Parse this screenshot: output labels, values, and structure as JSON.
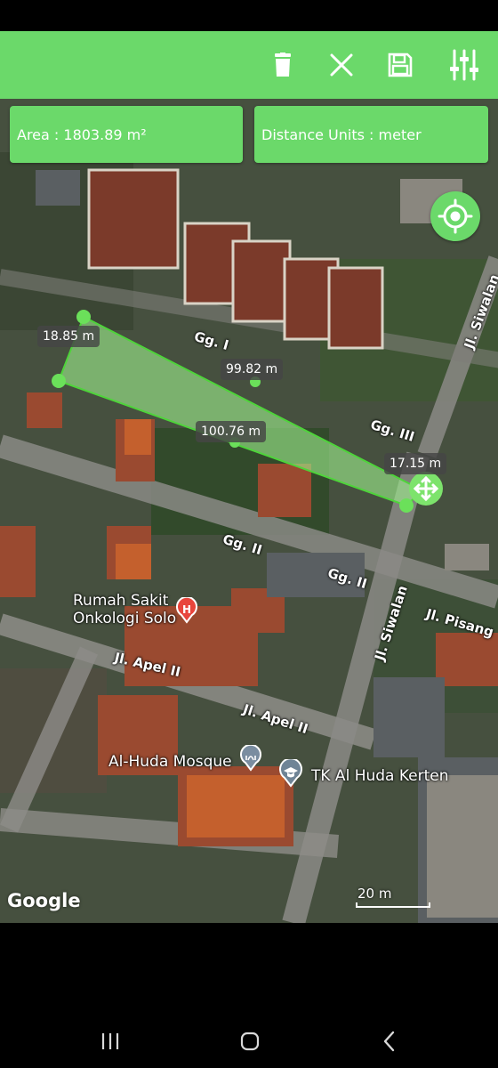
{
  "toolbar": {
    "delete_icon": "trash-icon",
    "close_icon": "close-icon",
    "save_icon": "save-icon",
    "settings_icon": "sliders-icon",
    "color": "#6bd96a"
  },
  "info": {
    "area": "Area : 1803.89 m²",
    "distance_units": "Distance Units : meter"
  },
  "map": {
    "locate_icon": "crosshair-icon",
    "move_icon": "move-icon",
    "polygon_fill": "#9ef28e",
    "polygon_stroke": "#4ed43a",
    "distance_labels": [
      "18.85 m",
      "99.82 m",
      "100.76 m",
      "17.15 m"
    ],
    "streets": {
      "gg1": "Gg. I",
      "gg3": "Gg. III",
      "gg2_a": "Gg. II",
      "gg2_b": "Gg. II",
      "siwalan_top": "Jl. Siwalan",
      "siwalan": "Jl. Siwalan",
      "pisang": "Jl. Pisang",
      "apel_a": "Jl. Apel II",
      "apel_b": "Jl. Apel II"
    },
    "pois": {
      "hospital_line1": "Rumah Sakit",
      "hospital_line2": "Onkologi Solo",
      "mosque": "Al-Huda Mosque",
      "school": "TK Al Huda Kerten"
    },
    "attribution": "Google",
    "scale": "20 m"
  },
  "navbar": {
    "recents_icon": "recents-icon",
    "home_icon": "home-icon",
    "back_icon": "back-icon"
  }
}
